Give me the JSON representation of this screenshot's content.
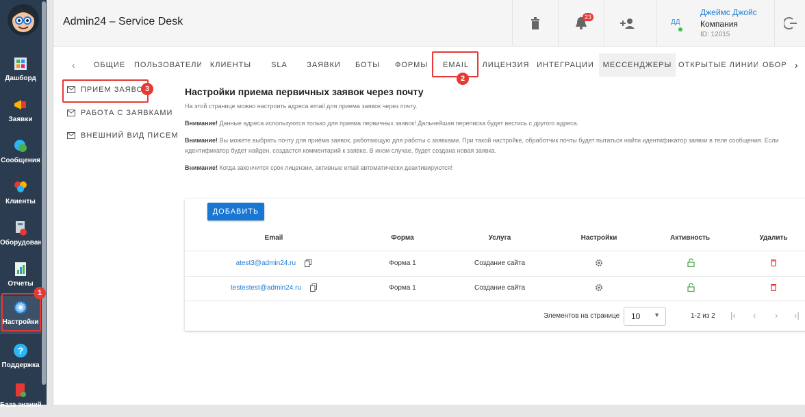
{
  "sidebar": {
    "items": [
      {
        "label": "Дашборд",
        "icon": "dashboard-icon"
      },
      {
        "label": "Заявки",
        "icon": "megaphone-icon"
      },
      {
        "label": "Сообщения",
        "icon": "chat-icon"
      },
      {
        "label": "Клиенты",
        "icon": "clients-icon"
      },
      {
        "label": "Оборудован...",
        "icon": "equipment-icon"
      },
      {
        "label": "Отчеты",
        "icon": "reports-icon"
      },
      {
        "label": "Настройки",
        "icon": "gear-icon"
      },
      {
        "label": "Поддержка",
        "icon": "help-icon"
      },
      {
        "label": "База знаний",
        "icon": "book-icon"
      }
    ]
  },
  "header": {
    "title": "Admin24 – Service Desk",
    "notifications_count": "23",
    "user": {
      "initials": "ДД",
      "name": "Джеймс Джойс",
      "company": "Компания",
      "id": "ID: 12015"
    }
  },
  "tabs": [
    "ОБЩИЕ",
    "ПОЛЬЗОВАТЕЛИ",
    "КЛИЕНТЫ",
    "SLA",
    "ЗАЯВКИ",
    "БОТЫ",
    "ФОРМЫ",
    "EMAIL",
    "ЛИЦЕНЗИЯ",
    "ИНТЕГРАЦИИ",
    "МЕССЕНДЖЕРЫ",
    "ОТКРЫТЫЕ ЛИНИИ",
    "ОБОР"
  ],
  "submenu": [
    "ПРИЕМ ЗАЯВОК",
    "РАБОТА С ЗАЯВКАМИ",
    "ВНЕШНИЙ ВИД ПИСЕМ"
  ],
  "content": {
    "title": "Настройки приема первичных заявок через почту",
    "intro": "На этой странице можно настроить адреса email для приема заявок через почту.",
    "warning_label": "Внимание!",
    "warn1": " Данные адреса используются только для приема первичных заявок! Дальнейшая переписка будет вестись с другого адреса.",
    "warn2": " Вы можете выбрать почту для приёма заявок, работающую для работы с заявками. При такой настройке, обработчик почты будет пытаться найти идентификатор заявки в теле сообщения. Если идентификатор будет найден, создастся комментарий к заявке. В ином случае, будет создана новая заявка.",
    "warn3": " Когда закончится срок лицензии, активные email автоматически деактивируются!"
  },
  "table": {
    "add_label": "ДОБАВИТЬ",
    "headers": [
      "Email",
      "Форма",
      "Услуга",
      "Настройки",
      "Активность",
      "Удалить"
    ],
    "rows": [
      {
        "email": "atest3@admin24.ru",
        "form": "Форма 1",
        "service": "Создание сайта"
      },
      {
        "email": "testestest@admin24.ru",
        "form": "Форма 1",
        "service": "Создание сайта"
      }
    ],
    "pager": {
      "per_page_label": "Элементов на странице",
      "per_page_value": "10",
      "range": "1-2 из 2"
    }
  },
  "annotations": [
    "1",
    "2",
    "3"
  ],
  "colors": {
    "sidebar_bg": "#2b3c50",
    "accent": "#1976d2",
    "highlight": "#e53935",
    "active_green": "#2ecc40"
  }
}
